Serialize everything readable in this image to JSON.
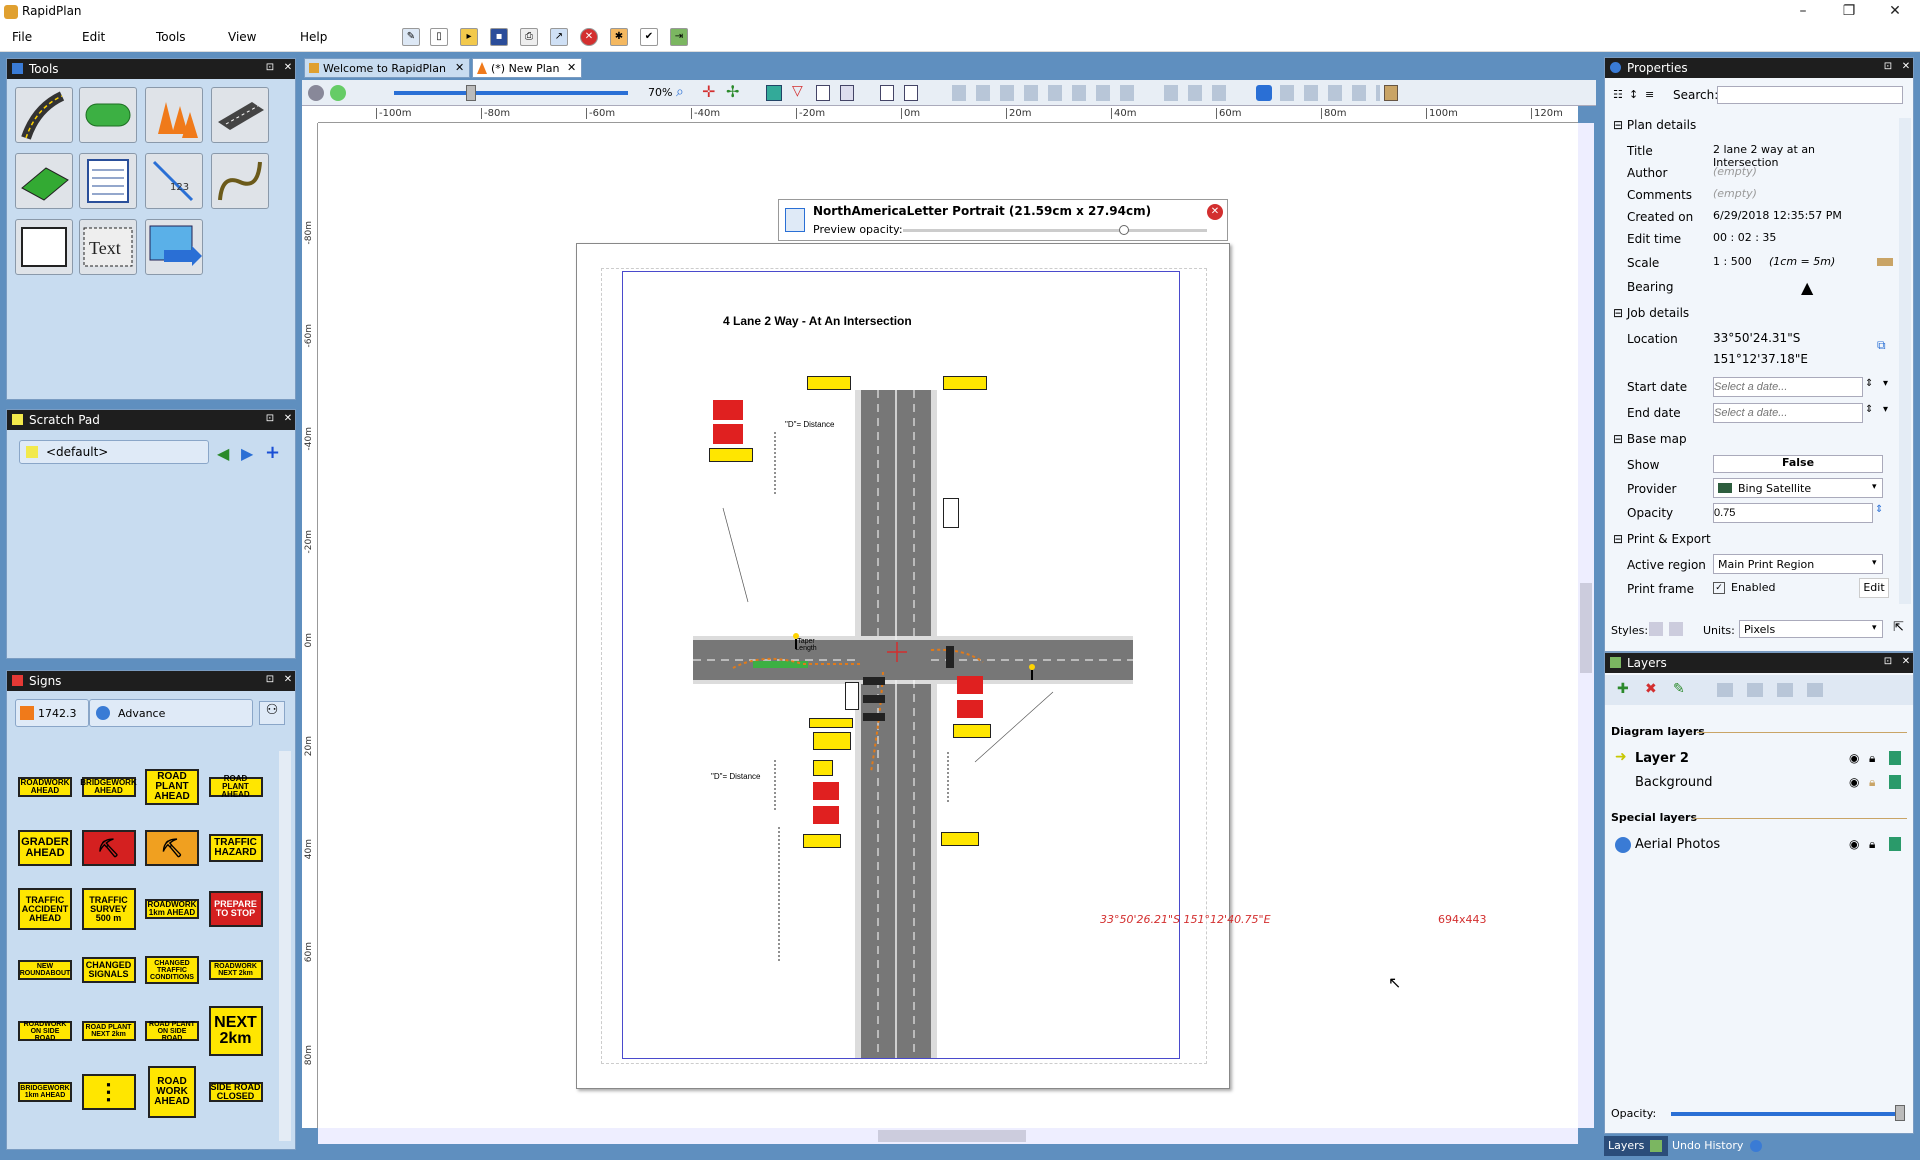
{
  "app": {
    "title": "RapidPlan"
  },
  "menu": [
    "File",
    "Edit",
    "Tools",
    "View",
    "Help"
  ],
  "tabs": [
    {
      "label": "Welcome to RapidPlan"
    },
    {
      "label": "(*) New Plan"
    }
  ],
  "panels": {
    "tools": "Tools",
    "scratch": "Scratch Pad",
    "signs": "Signs",
    "properties": "Properties",
    "layers": "Layers"
  },
  "scratch": {
    "selected": "<default>"
  },
  "signs": {
    "code": "1742.3",
    "category": "Advance",
    "items": [
      "ROADWORK AHEAD",
      "BRIDGEWORK AHEAD",
      "ROAD PLANT AHEAD",
      "ROAD PLANT AHEAD",
      "GRADER AHEAD",
      "",
      "",
      "TRAFFIC HAZARD",
      "TRAFFIC ACCIDENT AHEAD",
      "TRAFFIC SURVEY 500 m",
      "ROADWORK 1km AHEAD",
      "PREPARE TO STOP",
      "NEW ROUNDABOUT",
      "CHANGED SIGNALS",
      "CHANGED TRAFFIC CONDITIONS",
      "ROADWORK NEXT 2km",
      "ROADWORK ON SIDE ROAD",
      "ROAD PLANT NEXT 2km",
      "ROAD PLANT ON SIDE ROAD",
      "NEXT 2km",
      "BRIDGEWORK 1km AHEAD",
      "",
      "ROAD WORK AHEAD",
      "SIDE ROAD CLOSED"
    ]
  },
  "toolbar": {
    "zoom": "70%"
  },
  "ruler": {
    "h": [
      "-100m",
      "-80m",
      "-60m",
      "-40m",
      "-20m",
      "0m",
      "20m",
      "40m",
      "60m",
      "80m",
      "100m",
      "120m"
    ],
    "v": [
      "-80m",
      "-60m",
      "-40m",
      "-20m",
      "0m",
      "20m",
      "40m",
      "60m",
      "80m"
    ]
  },
  "preview": {
    "title": "NorthAmericaLetter Portrait (21.59cm x 27.94cm)",
    "opacity_label": "Preview opacity:"
  },
  "plan": {
    "title": "4 Lane 2 Way - At An Intersection",
    "distance_label": "\"D\"= Distance",
    "taper_label": "Taper Length"
  },
  "status": {
    "coords": "33°50'26.21\"S 151°12'40.75\"E",
    "size": "694x443"
  },
  "properties": {
    "search_label": "Search:",
    "plan_details": "Plan details",
    "title_k": "Title",
    "title_v": "2 lane 2 way at an Intersection",
    "author_k": "Author",
    "author_v": "(empty)",
    "comments_k": "Comments",
    "comments_v": "(empty)",
    "created_k": "Created on",
    "created_v": "6/29/2018 12:35:57 PM",
    "edit_k": "Edit time",
    "edit_v": "00 : 02 : 35",
    "scale_k": "Scale",
    "scale_v": "1 : 500",
    "scale_hint": "(1cm = 5m)",
    "bearing_k": "Bearing",
    "job_details": "Job details",
    "location_k": "Location",
    "location_v1": "33°50'24.31\"S",
    "location_v2": "151°12'37.18\"E",
    "start_k": "Start date",
    "start_ph": "Select a date...",
    "end_k": "End date",
    "end_ph": "Select a date...",
    "base_map": "Base map",
    "show_k": "Show",
    "show_v": "False",
    "provider_k": "Provider",
    "provider_v": "Bing Satellite",
    "opacity_k": "Opacity",
    "opacity_v": "0.75",
    "print_export": "Print & Export",
    "region_k": "Active region",
    "region_v": "Main Print Region",
    "frame_k": "Print frame",
    "frame_v": "Enabled",
    "frame_edit": "Edit",
    "styles_label": "Styles:",
    "units_label": "Units:",
    "units_v": "Pixels"
  },
  "layers": {
    "diagram": "Diagram layers",
    "layer2": "Layer 2",
    "background": "Background",
    "special": "Special layers",
    "aerial": "Aerial Photos",
    "opacity_label": "Opacity:",
    "tab_layers": "Layers",
    "tab_undo": "Undo History"
  }
}
